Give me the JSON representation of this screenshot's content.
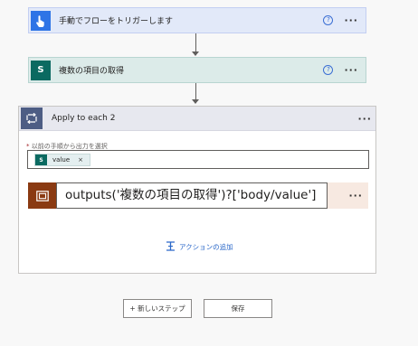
{
  "trigger": {
    "title": "手動でフローをトリガーします",
    "help": "?",
    "more": "···"
  },
  "get_items": {
    "title": "複数の項目の取得",
    "icon_text": "S",
    "help": "?",
    "more": "···"
  },
  "apply_each": {
    "title": "Apply to each 2",
    "more": "···",
    "field_label_req": "*",
    "field_label": "以前の手順から出力を選択",
    "token_label": "value",
    "token_icon": "S",
    "token_close": "×",
    "expression": "outputs('複数の項目の取得')?['body/value']",
    "expr_more": "···",
    "add_action": "アクションの追加"
  },
  "buttons": {
    "new_step": "+ 新しいステップ",
    "save": "保存"
  },
  "icons": {
    "trigger": "touch-hand-icon",
    "get_items": "sharepoint-icon",
    "loop": "loop-icon",
    "expression": "compose-icon",
    "add_action": "add-action-icon"
  },
  "colors": {
    "trigger_accent": "#2e74e6",
    "sharepoint_accent": "#0b6a61",
    "loop_accent": "#4d5d84",
    "expression_accent": "#8a3a12",
    "link": "#2b68c9"
  }
}
